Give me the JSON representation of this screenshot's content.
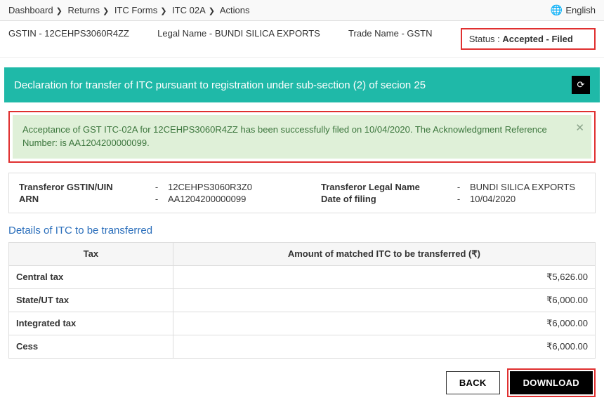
{
  "breadcrumb": [
    "Dashboard",
    "Returns",
    "ITC Forms",
    "ITC 02A",
    "Actions"
  ],
  "language": "English",
  "header": {
    "gstin_label": "GSTIN",
    "gstin": "12CEHPS3060R4ZZ",
    "legal_name_label": "Legal Name",
    "legal_name": "BUNDI SILICA EXPORTS",
    "trade_name_label": "Trade Name",
    "trade_name": "GSTN",
    "status_label": "Status :",
    "status_value": "Accepted - Filed"
  },
  "section_title": "Declaration for transfer of ITC pursuant to registration under sub-section (2) of secion 25",
  "alert": "Acceptance of GST ITC-02A for 12CEHPS3060R4ZZ has been successfully filed on 10/04/2020. The Acknowledgment Reference Number: is AA1204200000099.",
  "details": {
    "transferor_gstin_label": "Transferor GSTIN/UIN",
    "transferor_gstin": "12CEHPS3060R3Z0",
    "transferor_legal_name_label": "Transferor Legal Name",
    "transferor_legal_name": "BUNDI SILICA EXPORTS",
    "arn_label": "ARN",
    "arn": "AA1204200000099",
    "date_label": "Date of filing",
    "date": "10/04/2020"
  },
  "itc_title": "Details of ITC to be transferred",
  "table": {
    "col_tax": "Tax",
    "col_amount": "Amount of matched ITC to be transferred (₹)",
    "rows": [
      {
        "tax": "Central tax",
        "amount": "₹5,626.00"
      },
      {
        "tax": "State/UT tax",
        "amount": "₹6,000.00"
      },
      {
        "tax": "Integrated tax",
        "amount": "₹6,000.00"
      },
      {
        "tax": "Cess",
        "amount": "₹6,000.00"
      }
    ]
  },
  "buttons": {
    "back": "BACK",
    "download": "DOWNLOAD"
  }
}
